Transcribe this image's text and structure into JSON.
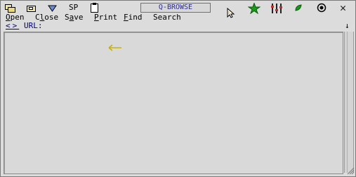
{
  "app": {
    "title": "Q-BROWSE"
  },
  "toolbar": {
    "sp_label": "SP",
    "icons": [
      "open-folder-icon",
      "close-folder-icon",
      "save-arrow-icon",
      "sp-label",
      "print-clipboard-icon"
    ],
    "right_icons": [
      "cursor-icon",
      "star-icon",
      "equalizer-icon",
      "leaf-icon",
      "target-icon",
      "close-icon"
    ]
  },
  "menu": {
    "open": {
      "u": "O",
      "rest": "pen"
    },
    "close": {
      "pre": "C",
      "u": "l",
      "rest": "ose"
    },
    "save": {
      "pre": "S",
      "u": "a",
      "rest": "ve"
    },
    "print": {
      "u": "P",
      "rest": "rint"
    },
    "find": {
      "u": "F",
      "rest": "ind"
    },
    "search": "Search"
  },
  "nav": {
    "back": "<",
    "forward": ">",
    "url_label": "URL:",
    "url_value": ""
  },
  "colors": {
    "background": "#dcdcdc",
    "title_text": "#2a2a9a",
    "star": "#1a9a1a",
    "pointer": "#c8b400"
  },
  "close_glyph": "✕",
  "down_glyph": "↓"
}
